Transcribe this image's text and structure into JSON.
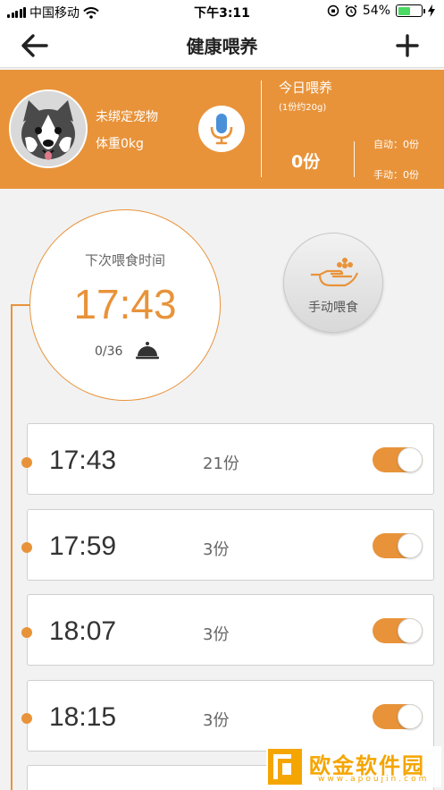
{
  "status_bar": {
    "carrier": "中国移动",
    "time": "下午3:11",
    "battery_percent": "54%",
    "battery_level": 0.54
  },
  "nav": {
    "title": "健康喂养"
  },
  "pet": {
    "name": "未绑定宠物",
    "weight": "体重0kg"
  },
  "today": {
    "title": "今日喂养",
    "note": "(1份约20g)",
    "total": "0份",
    "auto": "自动：0份",
    "manual": "手动：0份"
  },
  "next_feed": {
    "label": "下次喂食时间",
    "time": "17:43",
    "progress": "0/36"
  },
  "manual_feed": {
    "label": "手动喂食"
  },
  "schedule": [
    {
      "time": "17:43",
      "portion": "21份",
      "enabled": true
    },
    {
      "time": "17:59",
      "portion": "3份",
      "enabled": true
    },
    {
      "time": "18:07",
      "portion": "3份",
      "enabled": true
    },
    {
      "time": "18:15",
      "portion": "3份",
      "enabled": true
    }
  ],
  "watermark": {
    "text": "欧金软件园",
    "url": "www.apoujin.com"
  },
  "colors": {
    "accent": "#e8933a",
    "mic_blue": "#4a90d9"
  }
}
